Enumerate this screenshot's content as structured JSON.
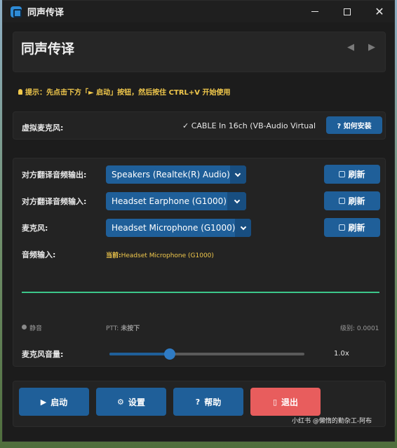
{
  "window": {
    "title": "同声传译",
    "minimize_icon": "minimize-icon",
    "maximize_icon": "maximize-icon",
    "close_glyph": "✕"
  },
  "header": {
    "title": "同声传译",
    "prev_glyph": "◀",
    "next_glyph": "▶"
  },
  "tip": {
    "text": "提示：先点击下方「► 启动」按钮，然后按住 CTRL+V 开始使用"
  },
  "virtual_mic": {
    "label": "虚拟麦克风:",
    "status": "✓ CABLE In 16ch (VB-Audio Virtual",
    "how_to_install": "? 如何安装"
  },
  "devices": {
    "partner_output": {
      "label": "对方翻译音频输出:",
      "value": "Speakers (Realtek(R) Audio)"
    },
    "partner_input": {
      "label": "对方翻译音频输入:",
      "value": "Headset Earphone (G1000)"
    },
    "microphone": {
      "label": "麦克风:",
      "value": "Headset Microphone (G1000)"
    },
    "refresh_label": "刷新"
  },
  "audio_input": {
    "label": "音频输入:",
    "current_prefix": "当前:",
    "current_device": "Headset Microphone (G1000)",
    "mute_label": "静音",
    "ptt_prefix": "PTT:",
    "ptt_state": "未按下",
    "level_prefix": "级别:",
    "level_value": "0.0001"
  },
  "mic_volume": {
    "label": "麦克风音量:",
    "value_text": "1.0x",
    "fraction": 0.31
  },
  "actions": {
    "start": "启动",
    "settings": "设置",
    "help": "帮助",
    "exit": "退出"
  },
  "watermark": "小红书 @懒惰的勤杂工-阿布",
  "colors": {
    "accent": "#1f5f99",
    "danger": "#e85d5d",
    "tip": "#f2c94c",
    "wave": "#3cc68a"
  }
}
